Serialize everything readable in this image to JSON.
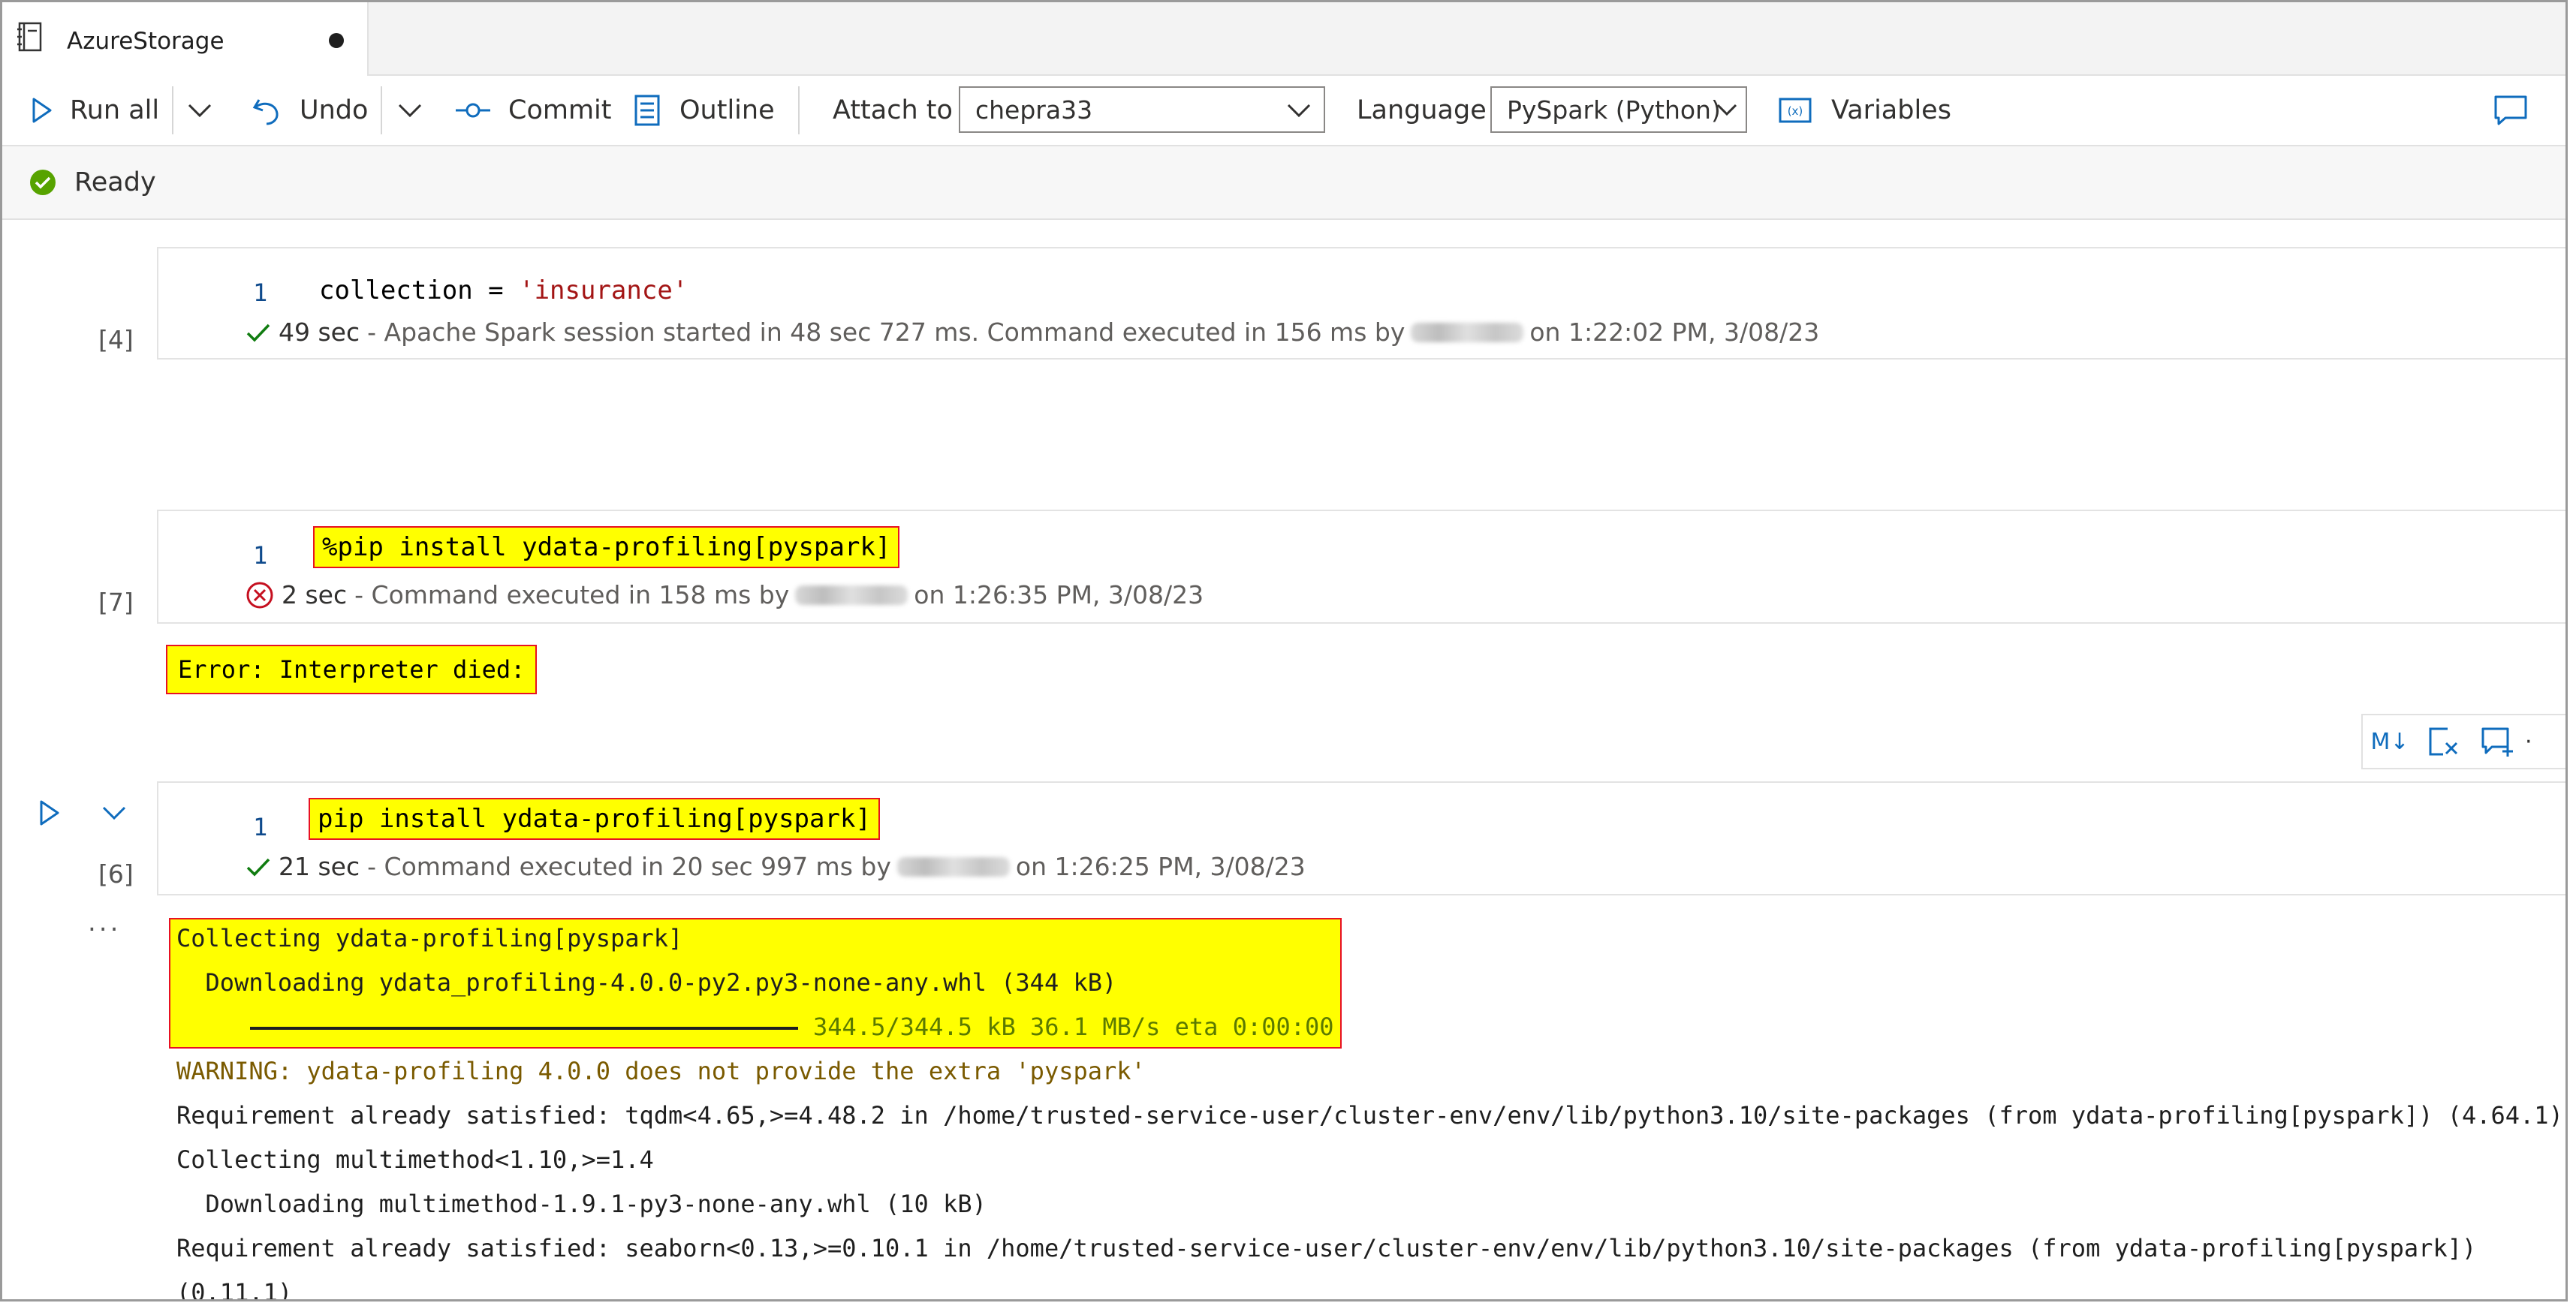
{
  "tab": {
    "title": "AzureStorage"
  },
  "toolbar": {
    "run_all": "Run all",
    "undo": "Undo",
    "commit": "Commit",
    "outline": "Outline",
    "attach_to_label": "Attach to",
    "attach_to_value": "chepra33",
    "language_label": "Language",
    "language_value": "PySpark (Python)",
    "variables": "Variables"
  },
  "status": {
    "text": "Ready",
    "color": "#57a300"
  },
  "cells": [
    {
      "exec_count": "[4]",
      "line_number": "1",
      "code_prefix": "collection = ",
      "code_string": "'insurance'",
      "duration": "49 sec",
      "message_a": "- Apache Spark session started in 48 sec 727 ms. Command executed in 156 ms by",
      "message_b": "on 1:22:02 PM, 3/08/23",
      "result": "success"
    },
    {
      "exec_count": "[7]",
      "line_number": "1",
      "code": "%pip install ydata-profiling[pyspark]",
      "duration": "2 sec",
      "message_a": "- Command executed in 158 ms by",
      "message_b": "on 1:26:35 PM, 3/08/23",
      "result": "error",
      "error_output": "Error: Interpreter died:"
    },
    {
      "exec_count": "[6]",
      "line_number": "1",
      "code": "pip install ydata-profiling[pyspark]",
      "duration": "21 sec",
      "message_a": "- Command executed in 20 sec 997 ms by",
      "message_b": "on 1:26:25 PM, 3/08/23",
      "result": "success"
    }
  ],
  "output_lines": {
    "l1": "Collecting ydata-profiling[pyspark]",
    "l2": "  Downloading ydata_profiling-4.0.0-py2.py3-none-any.whl (344 kB)",
    "l3_progress": "344.5/344.5 kB 36.1 MB/s eta 0:00:00",
    "l4": "WARNING: ydata-profiling 4.0.0 does not provide the extra 'pyspark'",
    "l5": "Requirement already satisfied: tqdm<4.65,>=4.48.2 in /home/trusted-service-user/cluster-env/env/lib/python3.10/site-packages (from ydata-profiling[pyspark]) (4.64.1)",
    "l6": "Collecting multimethod<1.10,>=1.4",
    "l7": "  Downloading multimethod-1.9.1-py3-none-any.whl (10 kB)",
    "l8": "Requirement already satisfied: seaborn<0.13,>=0.10.1 in /home/trusted-service-user/cluster-env/env/lib/python3.10/site-packages (from ydata-profiling[pyspark])",
    "l9": "(0.11.1)"
  },
  "mini_toolbar": {
    "markdown_label": "M↓"
  },
  "ellipsis": "...",
  "accent": "#0f6cbd"
}
